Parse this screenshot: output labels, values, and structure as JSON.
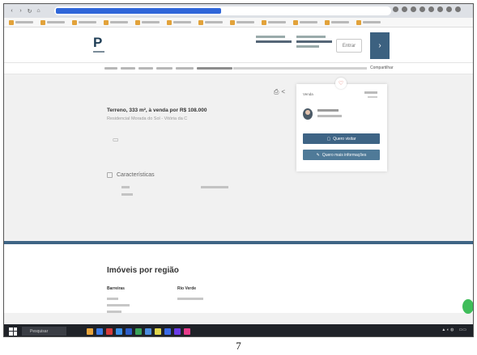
{
  "listing": {
    "title": "Terreno, 333 m², à venda por R$ 108.000",
    "location": "Residencial Morada do Sol - Vitória da C"
  },
  "features": {
    "section_title": "Características"
  },
  "contact_card": {
    "label": "Venda",
    "primary_button": "Quero visitar",
    "secondary_button": "Quero mais informações"
  },
  "header": {
    "login_label": "Entrar",
    "menu_icon": "menu-icon"
  },
  "breadcrumb": {
    "share_label": "Compartilhar"
  },
  "regions": {
    "title": "Imóveis por região",
    "col1_head": "Barreiras",
    "col2_head": "Rio Verde"
  },
  "taskbar": {
    "search_label": "Pesquisar"
  },
  "page": {
    "number": "7"
  },
  "colors": {
    "brand": "#3e6485",
    "whatsapp": "#3fbd5a"
  }
}
